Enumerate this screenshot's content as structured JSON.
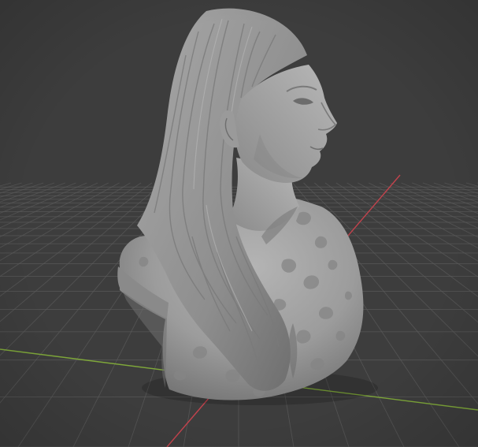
{
  "viewport": {
    "type": "3d-viewport",
    "background": "#3d3d3d",
    "grid_color": "#5a5a5a",
    "x_axis_color": "#c2434d",
    "y_axis_color": "#7fa83a",
    "model": {
      "name": "female-bust-sculpt",
      "surface_color": "#9e9e9e"
    }
  }
}
